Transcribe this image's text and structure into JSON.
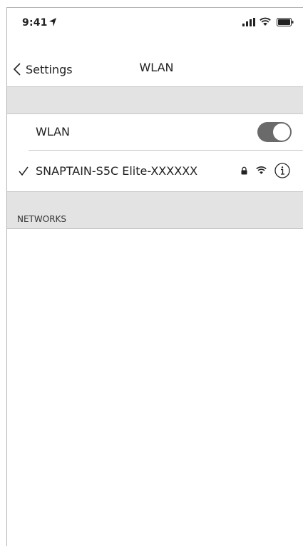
{
  "status_bar": {
    "time": "9:41",
    "icons": [
      "location-icon",
      "signal-icon",
      "wifi-icon",
      "battery-icon"
    ]
  },
  "nav": {
    "back_label": "Settings",
    "title": "WLAN"
  },
  "wlan_toggle": {
    "label": "WLAN",
    "enabled": true
  },
  "connected_network": {
    "name": "SNAPTAIN-S5C Elite-XXXXXX",
    "connected": true,
    "secured": true
  },
  "networks_section": {
    "header": "NETWORKS"
  },
  "colors": {
    "background": "#ffffff",
    "section_gray": "#e3e3e3",
    "toggle_on": "#6a6a6a",
    "text": "#222222"
  }
}
